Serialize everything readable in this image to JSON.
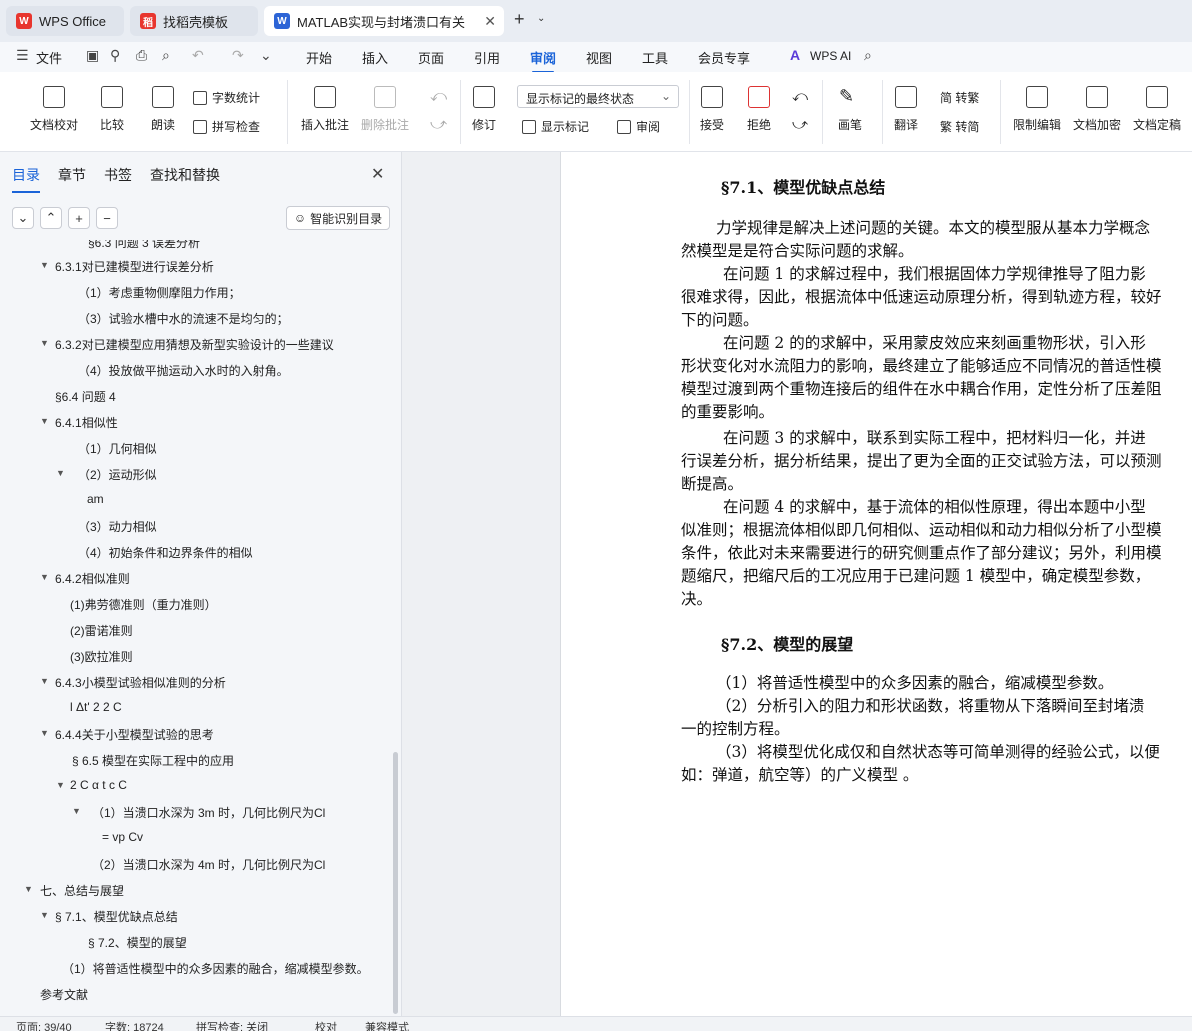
{
  "tabs": [
    {
      "label": "WPS Office",
      "icon": "wps-logo-icon"
    },
    {
      "label": "找稻壳模板",
      "icon": "daoke-icon"
    },
    {
      "label": "MATLAB实现与封堵溃口有关",
      "icon": "word-doc-icon"
    }
  ],
  "menu": {
    "file": "文件",
    "items": [
      "开始",
      "插入",
      "页面",
      "引用",
      "审阅",
      "视图",
      "工具",
      "会员专享"
    ],
    "active": "审阅",
    "ai": "WPS AI"
  },
  "ribbon": {
    "proofread": "文档校对",
    "compare": "比较",
    "read_aloud": "朗读",
    "word_count": "字数统计",
    "spell_check": "拼写检查",
    "insert_comment": "插入批注",
    "delete_comment": "删除批注",
    "revise": "修订",
    "markup_state": "显示标记的最终状态",
    "show_markup": "显示标记",
    "review": "审阅",
    "accept": "接受",
    "reject": "拒绝",
    "pen": "画笔",
    "translate": "翻译",
    "to_traditional": "简 转繁",
    "to_simplified": "繁 转简",
    "restrict_edit": "限制编辑",
    "encrypt": "文档加密",
    "finalize": "文档定稿"
  },
  "sidebar": {
    "tabs": [
      "目录",
      "章节",
      "书签",
      "查找和替换"
    ],
    "smart_button": "智能识别目录",
    "toc": [
      "§6.3 问题 3 误差分析",
      "6.3.1对已建模型进行误差分析",
      "（1）考虑重物侧摩阻力作用；",
      "（3）试验水槽中水的流速不是均匀的；",
      "6.3.2对已建模型应用猜想及新型实验设计的一些建议",
      "（4）投放做平抛运动入水时的入射角。",
      "§6.4 问题 4",
      "6.4.1相似性",
      "（1）几何相似",
      "（2）运动形似",
      "am",
      "（3）动力相似",
      "（4）初始条件和边界条件的相似",
      "6.4.2相似准则",
      "(1)弗劳德准则（重力准则）",
      "(2)雷诺准则",
      "(3)欧拉准则",
      "6.4.3小模型试验相似准则的分析",
      "l Δt'  2     2 C",
      "6.4.4关于小型模型试验的思考",
      "§ 6.5 模型在实际工程中的应用",
      "2    C α t    c  C",
      "（1）当溃口水深为 3m 时，几何比例尺为Cl",
      "= vp  Cv",
      "（2）当溃口水深为 4m 时，几何比例尺为Cl",
      "七、总结与展望",
      "§ 7.1、模型优缺点总结",
      "§ 7.2、模型的展望",
      "（1）将普适性模型中的众多因素的融合，缩减模型参数。",
      "参考文献"
    ]
  },
  "doc": {
    "heading1": "§7.1、模型优缺点总结",
    "para": [
      "力学规律是解决上述问题的关键。本文的模型服从基本力学概念",
      "然模型是是符合实际问题的求解。",
      "在问题 1 的求解过程中，我们根据固体力学规律推导了阻力影",
      "很难求得，因此，根据流体中低速运动原理分析，得到轨迹方程，较好",
      "下的问题。",
      "在问题 2 的的求解中，采用蒙皮效应来刻画重物形状，引入形",
      "形状变化对水流阻力的影响，最终建立了能够适应不同情况的普适性模",
      "模型过渡到两个重物连接后的组件在水中耦合作用，定性分析了压差阻",
      "的重要影响。",
      "在问题 3 的求解中，联系到实际工程中，把材料归一化，并进",
      "行误差分析，据分析结果，提出了更为全面的正交试验方法，可以预测",
      "断提高。",
      "在问题 4 的求解中，基于流体的相似性原理，得出本题中小型",
      "似准则；根据流体相似即几何相似、运动相似和动力相似分析了小型模",
      "条件，依此对未来需要进行的研究侧重点作了部分建议；另外，利用模",
      "题缩尺，把缩尺后的工况应用于已建问题 1 模型中，确定模型参数，",
      "决。"
    ],
    "heading2": "§7.2、模型的展望",
    "para2": [
      "（1）将普适性模型中的众多因素的融合，缩减模型参数。",
      "（2）分析引入的阻力和形状函数，将重物从下落瞬间至封堵溃",
      "一的控制方程。",
      "（3）将模型优化成仅和自然状态等可简单测得的经验公式，以便",
      "如：弹道，航空等）的广义模型 。"
    ]
  },
  "status": {
    "page": "页面: 39/40",
    "words": "字数: 18724",
    "spell": "拼写检查: 关闭",
    "proof": "校对",
    "compat": "兼容模式"
  }
}
